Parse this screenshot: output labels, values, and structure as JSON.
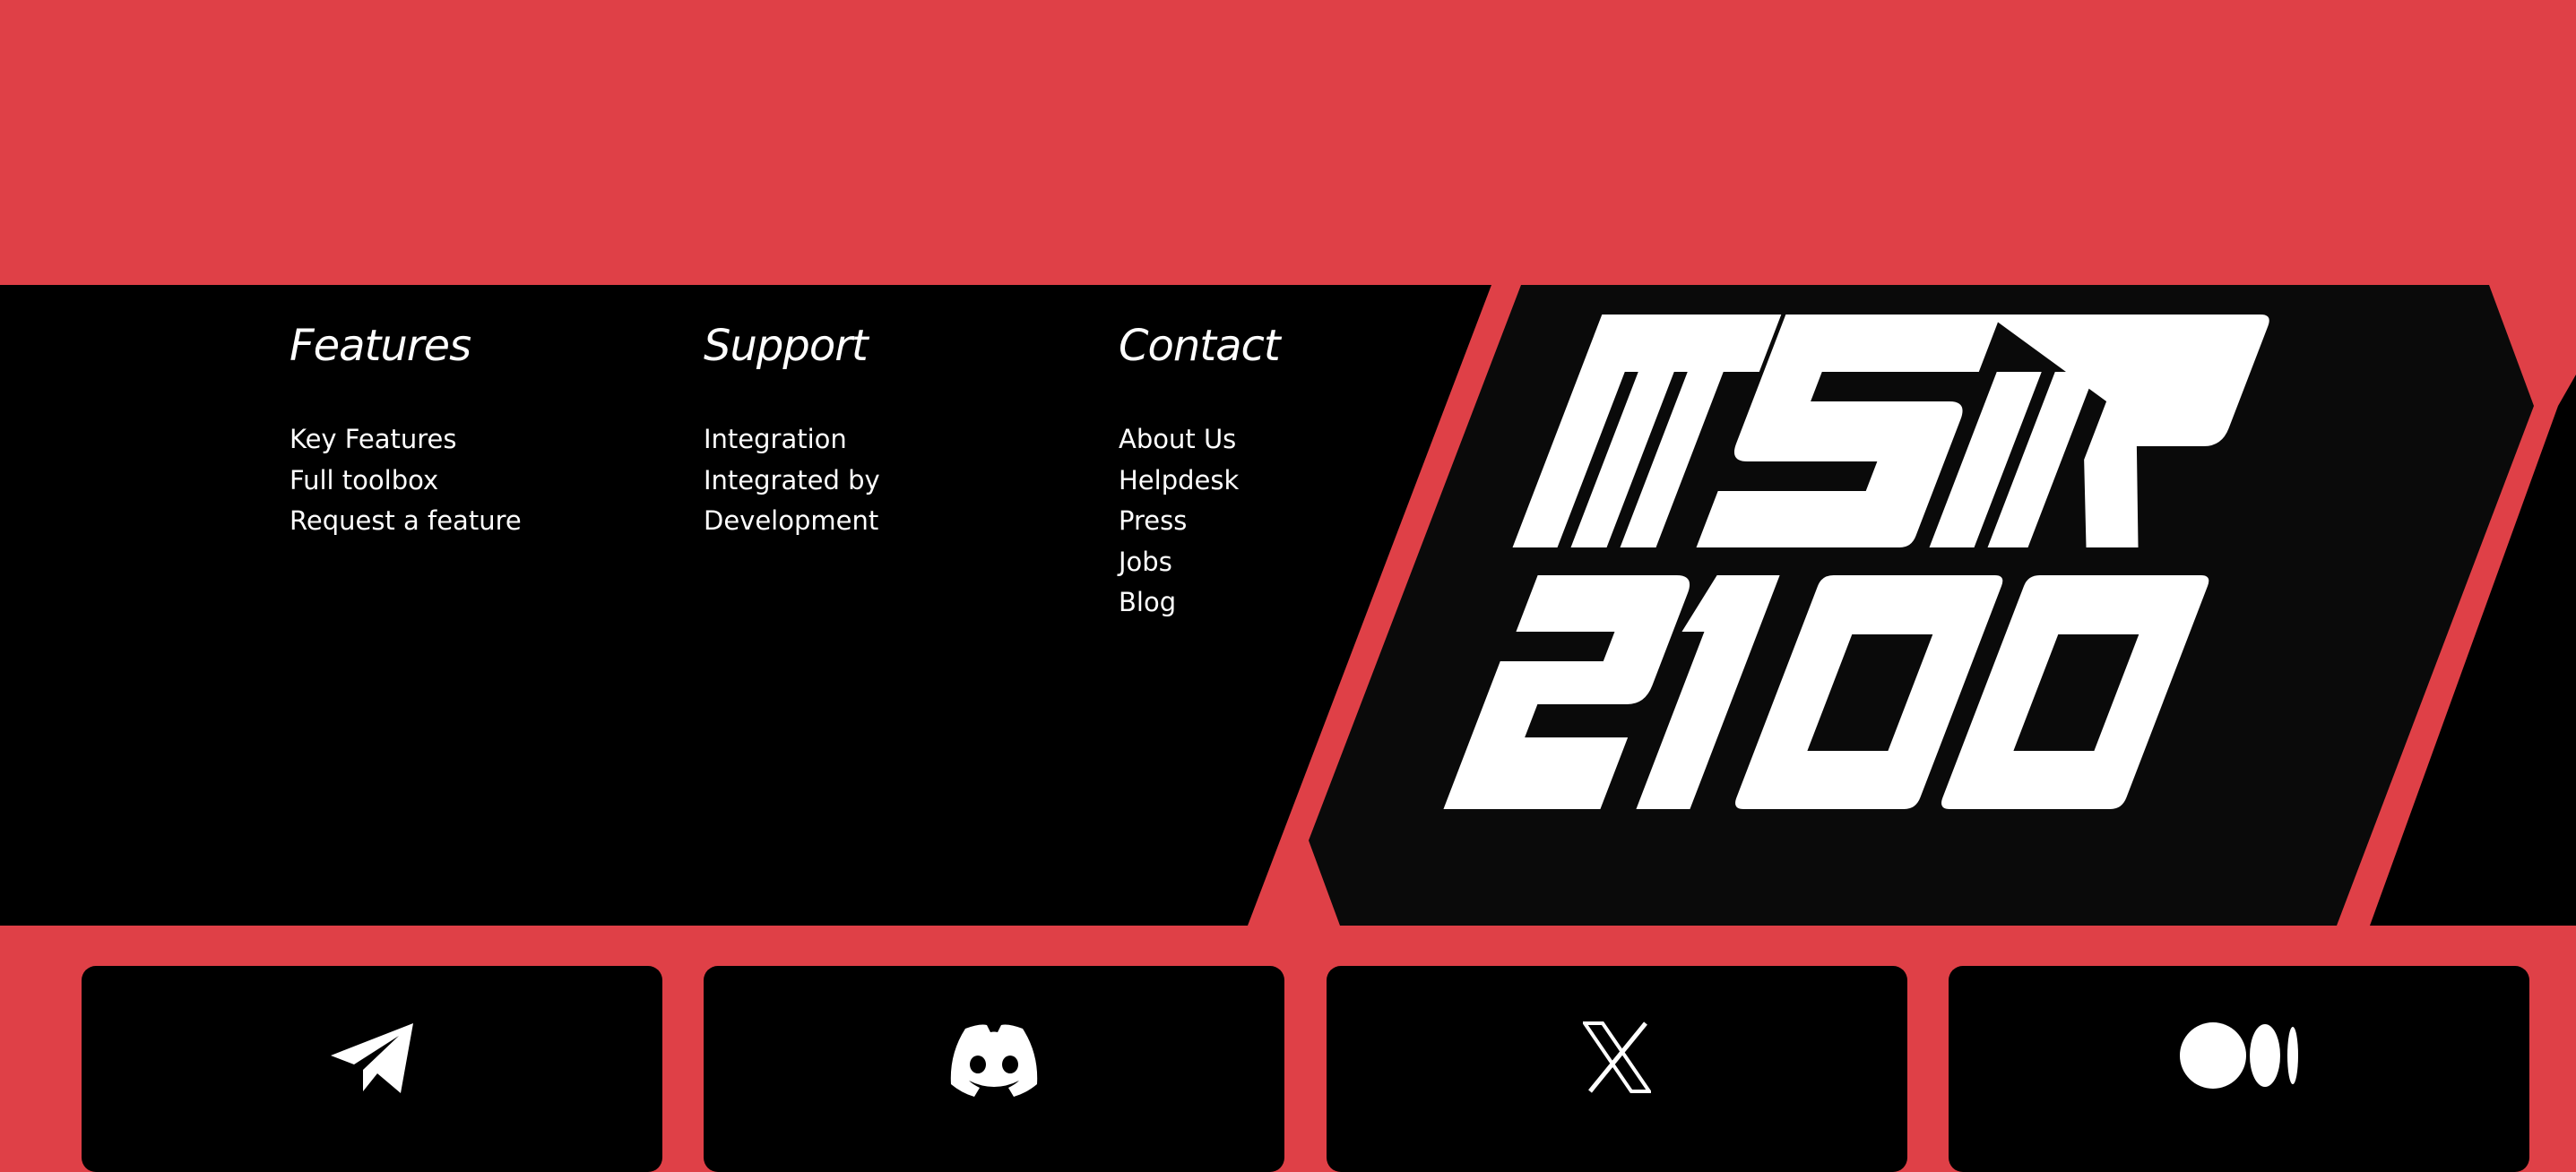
{
  "footer": {
    "columns": [
      {
        "heading": "Features",
        "links": [
          "Key Features",
          "Full toolbox",
          "Request a feature"
        ]
      },
      {
        "heading": "Support",
        "links": [
          "Integration",
          "Integrated by",
          "Development"
        ]
      },
      {
        "heading": "Contact",
        "links": [
          "About Us",
          "Helpdesk",
          "Press",
          "Jobs",
          "Blog"
        ]
      }
    ],
    "logo": {
      "text_line_1": "MSTR",
      "text_line_2": "2100"
    }
  },
  "social": {
    "cards": [
      {
        "icon": "telegram-icon"
      },
      {
        "icon": "discord-icon"
      },
      {
        "icon": "x-icon"
      },
      {
        "icon": "medium-icon"
      }
    ]
  },
  "colors": {
    "accent": "#df4047",
    "panel": "#000000",
    "logo_panel": "#0a0a0a",
    "text": "#ffffff"
  }
}
